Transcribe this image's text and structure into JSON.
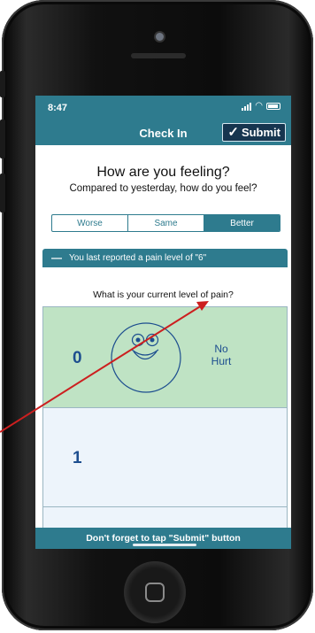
{
  "status_bar": {
    "time": "8:47"
  },
  "nav": {
    "title": "Check In",
    "submit_label": "Submit"
  },
  "checkin": {
    "heading": "How are you feeling?",
    "subheading": "Compared to yesterday, how do you feel?",
    "options": [
      "Worse",
      "Same",
      "Better"
    ],
    "selected": "Better"
  },
  "banner": {
    "text": "You last reported a pain level of \"6\""
  },
  "question": "What is your current level of pain?",
  "pain_levels": [
    {
      "number": "0",
      "label_line1": "No",
      "label_line2": "Hurt"
    },
    {
      "number": "1"
    }
  ],
  "footer": "Don't forget to tap \"Submit\" button",
  "colors": {
    "primary": "#2e7b8e",
    "submit_bg": "#16354f",
    "selected_row": "#bfe3c4",
    "row": "#edf4fb",
    "number": "#1d4e8f",
    "arrow": "#cc1f1f"
  }
}
